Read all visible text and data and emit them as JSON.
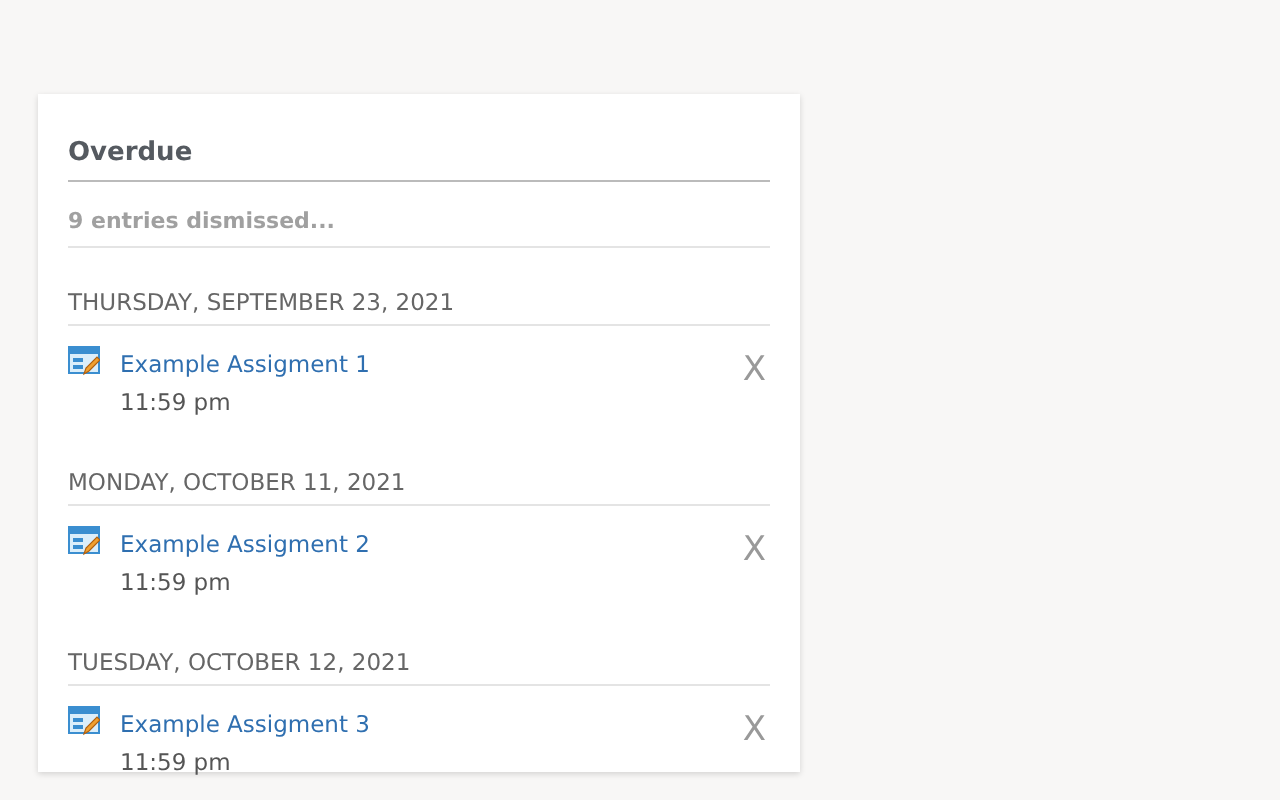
{
  "panel": {
    "title": "Overdue",
    "dismissed_link": "9 entries dismissed..."
  },
  "groups": [
    {
      "date": "THURSDAY, SEPTEMBER 23, 2021",
      "items": [
        {
          "title": "Example Assigment 1",
          "time": "11:59 pm",
          "dismiss": "X"
        }
      ]
    },
    {
      "date": "MONDAY, OCTOBER 11, 2021",
      "items": [
        {
          "title": "Example Assigment 2",
          "time": "11:59 pm",
          "dismiss": "X"
        }
      ]
    },
    {
      "date": "TUESDAY, OCTOBER 12, 2021",
      "items": [
        {
          "title": "Example Assigment 3",
          "time": "11:59 pm",
          "dismiss": "X"
        }
      ]
    }
  ]
}
